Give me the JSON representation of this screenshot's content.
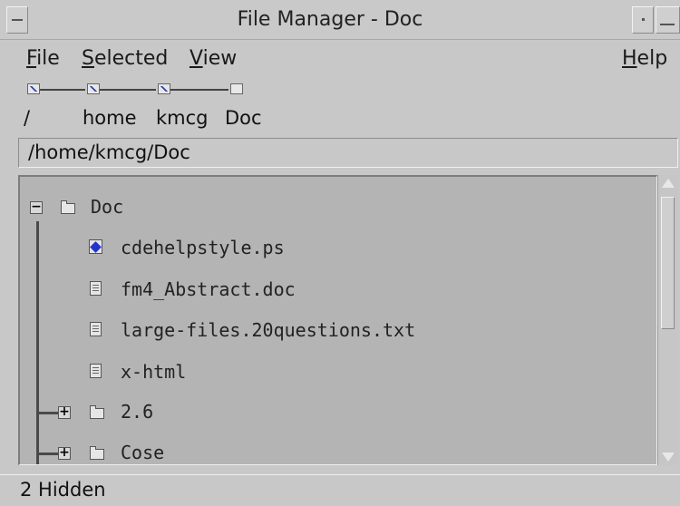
{
  "window": {
    "title": "File Manager - Doc"
  },
  "menu": {
    "file": {
      "mnemonic": "F",
      "rest": "ile"
    },
    "selected": {
      "mnemonic": "S",
      "rest": "elected"
    },
    "view": {
      "mnemonic": "V",
      "rest": "iew"
    },
    "help": {
      "mnemonic": "H",
      "rest": "elp"
    }
  },
  "breadcrumb": {
    "items": [
      "/",
      "home",
      "kmcg",
      "Doc"
    ]
  },
  "path": {
    "value": "/home/kmcg/Doc"
  },
  "tree": {
    "root": {
      "label": "Doc",
      "expander": "−"
    },
    "files": [
      {
        "label": "cdehelpstyle.ps",
        "icon": "postscript-file-icon"
      },
      {
        "label": "fm4_Abstract.doc",
        "icon": "document-file-icon"
      },
      {
        "label": "large-files.20questions.txt",
        "icon": "document-file-icon"
      },
      {
        "label": "x-html",
        "icon": "document-file-icon"
      }
    ],
    "folders": [
      {
        "label": "2.6",
        "expander": "+"
      },
      {
        "label": "Cose",
        "expander": "+"
      }
    ]
  },
  "status": {
    "text": "2 Hidden"
  }
}
